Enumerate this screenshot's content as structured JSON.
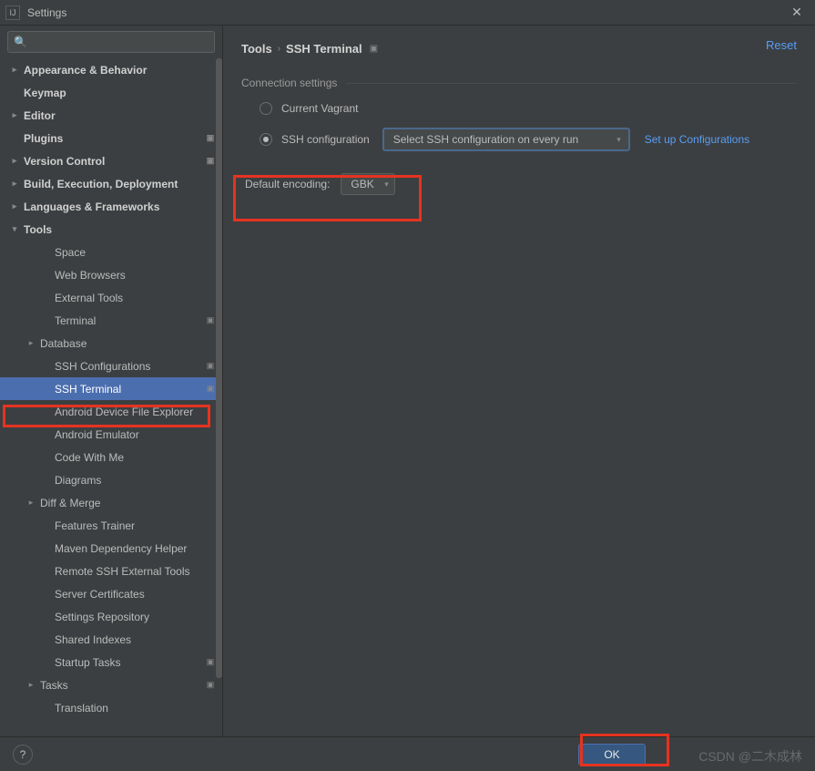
{
  "window": {
    "title": "Settings"
  },
  "search": {
    "placeholder": ""
  },
  "sidebar": {
    "items": [
      {
        "label": "Appearance & Behavior",
        "bold": true,
        "arrow": "col",
        "pad": 0
      },
      {
        "label": "Keymap",
        "bold": true,
        "pad": 0,
        "spacer": true
      },
      {
        "label": "Editor",
        "bold": true,
        "arrow": "col",
        "pad": 0
      },
      {
        "label": "Plugins",
        "bold": true,
        "pad": 0,
        "spacer": true,
        "badge": true
      },
      {
        "label": "Version Control",
        "bold": true,
        "arrow": "col",
        "pad": 0,
        "badge": true
      },
      {
        "label": "Build, Execution, Deployment",
        "bold": true,
        "arrow": "col",
        "pad": 0
      },
      {
        "label": "Languages & Frameworks",
        "bold": true,
        "arrow": "col",
        "pad": 0
      },
      {
        "label": "Tools",
        "bold": true,
        "arrow": "exp",
        "pad": 0
      },
      {
        "label": "Space",
        "pad": 2
      },
      {
        "label": "Web Browsers",
        "pad": 2
      },
      {
        "label": "External Tools",
        "pad": 2
      },
      {
        "label": "Terminal",
        "pad": 2,
        "badge": true
      },
      {
        "label": "Database",
        "arrow": "col",
        "pad": 1
      },
      {
        "label": "SSH Configurations",
        "pad": 2,
        "badge": true
      },
      {
        "label": "SSH Terminal",
        "pad": 2,
        "badge": true,
        "selected": true
      },
      {
        "label": "Android Device File Explorer",
        "pad": 2
      },
      {
        "label": "Android Emulator",
        "pad": 2
      },
      {
        "label": "Code With Me",
        "pad": 2
      },
      {
        "label": "Diagrams",
        "pad": 2
      },
      {
        "label": "Diff & Merge",
        "arrow": "col",
        "pad": 1
      },
      {
        "label": "Features Trainer",
        "pad": 2
      },
      {
        "label": "Maven Dependency Helper",
        "pad": 2
      },
      {
        "label": "Remote SSH External Tools",
        "pad": 2
      },
      {
        "label": "Server Certificates",
        "pad": 2
      },
      {
        "label": "Settings Repository",
        "pad": 2
      },
      {
        "label": "Shared Indexes",
        "pad": 2
      },
      {
        "label": "Startup Tasks",
        "pad": 2,
        "badge": true
      },
      {
        "label": "Tasks",
        "arrow": "col",
        "pad": 1,
        "badge": true
      },
      {
        "label": "Translation",
        "pad": 2
      }
    ]
  },
  "breadcrumb": {
    "root": "Tools",
    "leaf": "SSH Terminal"
  },
  "actions": {
    "reset": "Reset"
  },
  "section": {
    "connection": "Connection settings"
  },
  "radios": {
    "vagrant": "Current Vagrant",
    "sshconf": "SSH configuration"
  },
  "sshSelect": {
    "value": "Select SSH configuration on every run"
  },
  "setupLink": "Set up Configurations",
  "encoding": {
    "label": "Default encoding:",
    "value": "GBK"
  },
  "footer": {
    "ok": "OK"
  },
  "watermark": "CSDN @二木成林"
}
